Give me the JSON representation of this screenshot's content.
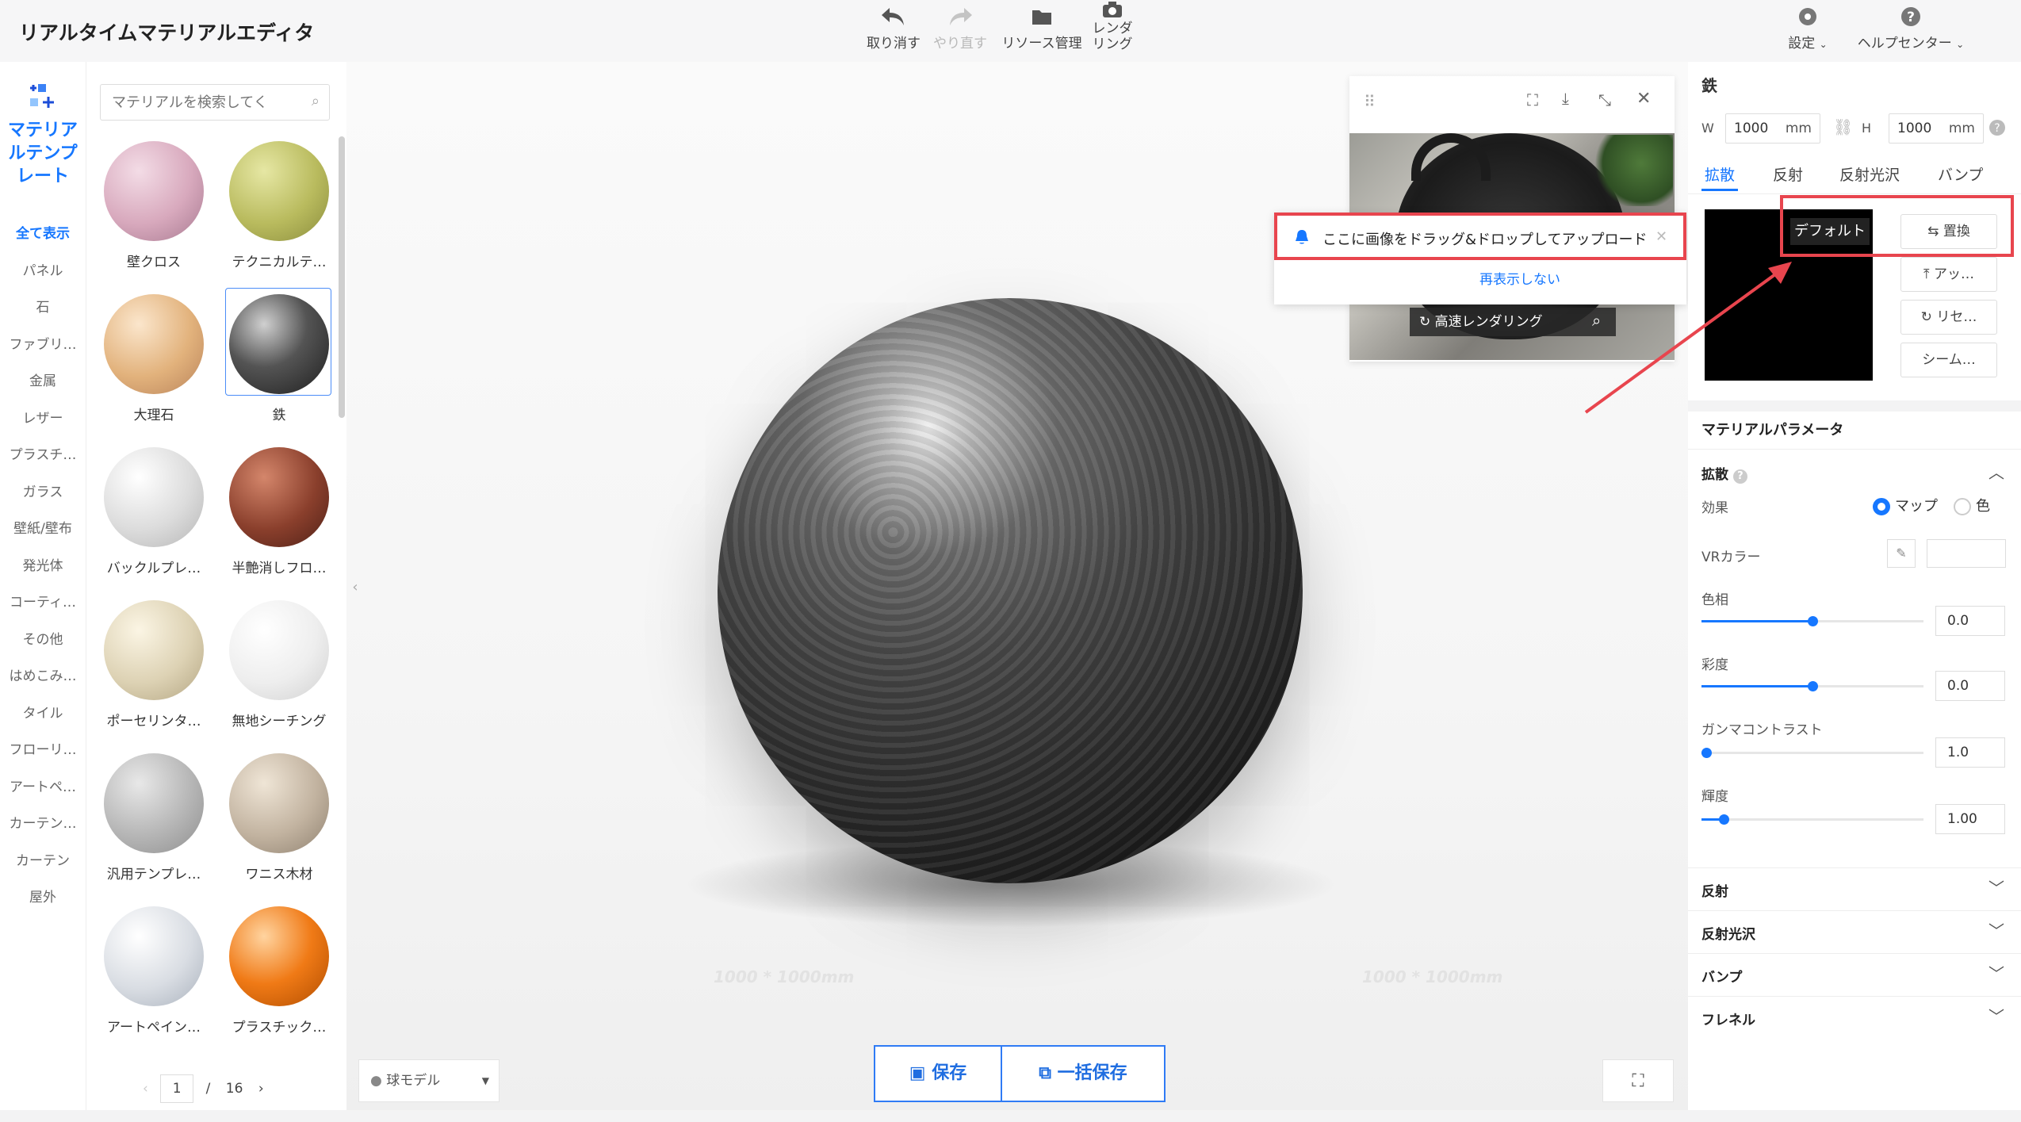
{
  "app": {
    "title": "リアルタイムマテリアルエディタ"
  },
  "toolbar": {
    "undo": "取り消す",
    "redo": "やり直す",
    "resources": "リソース管理",
    "render": "レンダ\nリング",
    "settings": "設定",
    "help": "ヘルプセンター"
  },
  "sidebar": {
    "template_label": "マテリアルテンプレート",
    "categories": [
      "全て表示",
      "パネル",
      "石",
      "ファブリ…",
      "金属",
      "レザー",
      "プラスチ…",
      "ガラス",
      "壁紙/壁布",
      "発光体",
      "コーティ…",
      "その他",
      "はめこみ…",
      "タイル",
      "フローリ…",
      "アートペ…",
      "カーテン…",
      "カーテン",
      "屋外"
    ]
  },
  "materials": {
    "search_placeholder": "マテリアルを検索してく",
    "items": [
      {
        "label": "壁クロス"
      },
      {
        "label": "テクニカルテ…"
      },
      {
        "label": "大理石"
      },
      {
        "label": "鉄"
      },
      {
        "label": "バックルプレ…"
      },
      {
        "label": "半艶消しフロ…"
      },
      {
        "label": "ポーセリンタ…"
      },
      {
        "label": "無地シーチング"
      },
      {
        "label": "汎用テンプレ…"
      },
      {
        "label": "ワニス木材"
      },
      {
        "label": "アートペイン…"
      },
      {
        "label": "プラスチック…"
      }
    ],
    "page_current": "1",
    "page_total": "16"
  },
  "viewport": {
    "floor_label_left": "1000 * 1000mm",
    "floor_label_right": "1000 * 1000mm",
    "fast_render": "高速レンダリング",
    "model_select": "球モデル",
    "save": "保存",
    "batch_save": "一括保存"
  },
  "toast": {
    "message": "ここに画像をドラッグ&ドロップしてアップロード",
    "dismiss": "再表示しない"
  },
  "right": {
    "name": "鉄",
    "w_label": "W",
    "w_value": "1000",
    "w_unit": "mm",
    "h_label": "H",
    "h_value": "1000",
    "h_unit": "mm",
    "tabs": [
      "拡散",
      "反射",
      "反射光沢",
      "バンプ"
    ],
    "default_chip": "デフォルト",
    "replace": "置換",
    "upload": "アッ…",
    "reset": "リセ…",
    "seam": "シーム…",
    "params_title": "マテリアルパラメータ",
    "diffuse": "拡散",
    "effect": "効果",
    "map": "マップ",
    "color": "色",
    "vr_color": "VRカラー",
    "hue": "色相",
    "hue_val": "0.0",
    "sat": "彩度",
    "sat_val": "0.0",
    "gamma": "ガンマコントラスト",
    "gamma_val": "1.0",
    "bright": "輝度",
    "bright_val": "1.00",
    "reflect": "反射",
    "reflect_gloss": "反射光沢",
    "bump": "バンプ",
    "fresnel": "フレネル"
  },
  "colors": {
    "accent": "#1677ff",
    "annotation": "#e8454e"
  }
}
